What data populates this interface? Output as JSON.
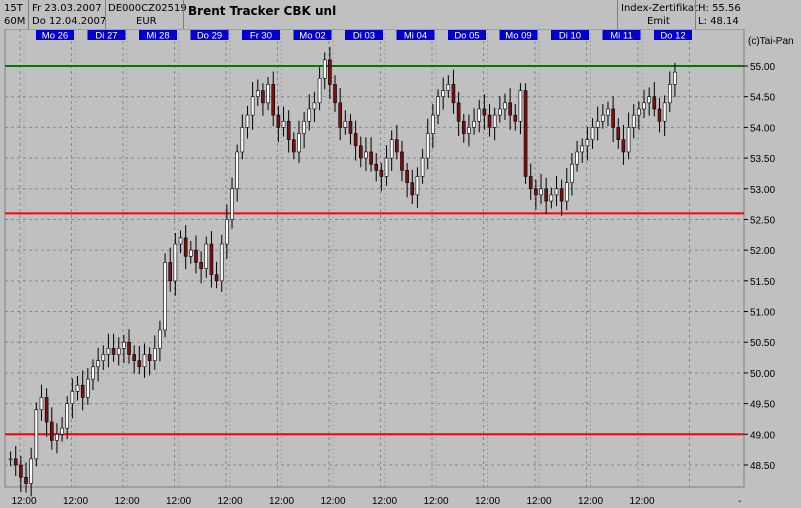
{
  "header": {
    "interval_top": "15T",
    "interval_bottom": "60M",
    "date_from": "Fr 23.03.2007",
    "date_to": "Do 12.04.2007",
    "isin": "DE000CZ02519",
    "currency": "EUR",
    "title": "Brent Tracker   CBK  unl",
    "product_type": "Index-Zertifikat",
    "issuer": "Emit",
    "high": "H: 55.56",
    "low": "L: 48.14"
  },
  "copyright": "(c)Tai-Pan",
  "colors": {
    "background": "#c0c0c0",
    "grid": "#8a8a8a",
    "up_candle": "#ffffff",
    "down_candle": "#7a1010",
    "support_line": "#ff0000",
    "resistance_line": "#007a00",
    "day_label_bg": "#0000cc",
    "day_label_text": "#ffffff"
  },
  "chart_data": {
    "type": "candlestick",
    "title": "Brent Tracker   CBK  unl",
    "y_range": [
      48.1,
      55.6
    ],
    "y_ticks": [
      48.5,
      49.0,
      49.5,
      50.0,
      50.5,
      51.0,
      51.5,
      52.0,
      52.5,
      53.0,
      53.5,
      54.0,
      54.5,
      55.0
    ],
    "y_tick_labels": [
      "48.50",
      "49.00",
      "49.50",
      "50.00",
      "50.50",
      "51.00",
      "51.50",
      "52.00",
      "52.50",
      "53.00",
      "53.50",
      "54.00",
      "54.50",
      "55.00"
    ],
    "day_labels": [
      "Mo 26",
      "Di 27",
      "Mi 28",
      "Do 29",
      "Fr 30",
      "Mo 02",
      "Di 03",
      "Mi 04",
      "Do 05",
      "Mo 09",
      "Di 10",
      "Mi 11",
      "Do 12"
    ],
    "x_tick_label": "12:00",
    "x_tick_count": 14,
    "horizontal_lines": [
      {
        "value": 55.0,
        "color": "#007a00"
      },
      {
        "value": 52.6,
        "color": "#ff0000"
      },
      {
        "value": 49.0,
        "color": "#ff0000"
      }
    ],
    "candles_per_day": 10,
    "approx_closes_by_day": [
      [
        48.6,
        48.5,
        48.3,
        48.2,
        48.6,
        49.4,
        49.6,
        49.2,
        48.9,
        49.0
      ],
      [
        49.1,
        49.5,
        49.7,
        49.8,
        49.6,
        49.9,
        50.1,
        50.2,
        50.3,
        50.4
      ],
      [
        50.3,
        50.4,
        50.5,
        50.3,
        50.2,
        50.1,
        50.3,
        50.2,
        50.4,
        50.7
      ],
      [
        51.8,
        51.5,
        52.1,
        52.2,
        51.9,
        52.0,
        51.8,
        51.7,
        52.1,
        51.6
      ],
      [
        51.5,
        52.1,
        52.5,
        53.0,
        53.6,
        54.0,
        54.2,
        54.5,
        54.6,
        54.4
      ],
      [
        54.7,
        54.2,
        54.0,
        54.1,
        53.8,
        53.6,
        53.9,
        54.1,
        54.3,
        54.4
      ],
      [
        54.8,
        55.1,
        54.7,
        54.4,
        54.0,
        54.1,
        53.9,
        53.7,
        53.5,
        53.6
      ],
      [
        53.4,
        53.3,
        53.2,
        53.5,
        53.8,
        53.6,
        53.3,
        53.1,
        52.9,
        53.2
      ],
      [
        53.5,
        53.9,
        54.2,
        54.5,
        54.6,
        54.7,
        54.4,
        54.1,
        53.9,
        54.0
      ],
      [
        54.1,
        54.3,
        54.2,
        54.0,
        54.2,
        54.3,
        54.4,
        54.2,
        54.1,
        54.6
      ],
      [
        53.2,
        53.0,
        52.9,
        53.0,
        52.8,
        52.9,
        53.0,
        52.8,
        53.1,
        53.4
      ],
      [
        53.6,
        53.7,
        53.8,
        54.0,
        54.1,
        54.2,
        54.3,
        54.0,
        53.8,
        53.6
      ],
      [
        54.0,
        54.2,
        54.3,
        54.4,
        54.5,
        54.3,
        54.1,
        54.4,
        54.7,
        54.9
      ]
    ]
  }
}
